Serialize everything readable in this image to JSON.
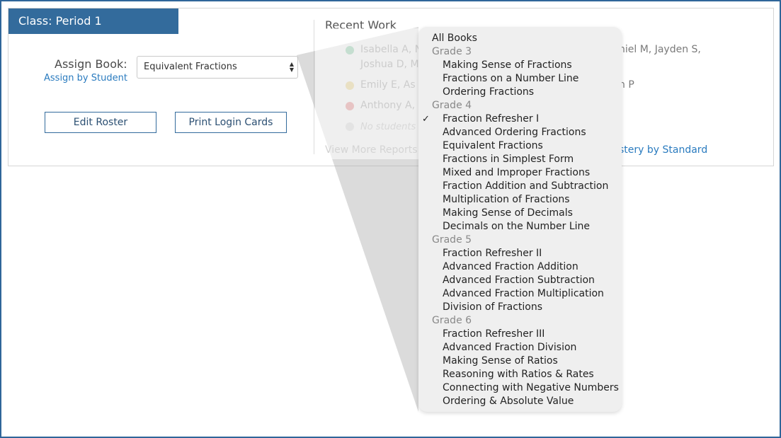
{
  "class_header": "Class: Period 1",
  "assign": {
    "label": "Assign Book:",
    "by_student_link": "Assign by Student",
    "selected_book": "Equivalent Fractions"
  },
  "buttons": {
    "edit_roster": "Edit Roster",
    "print_login_cards": "Print Login Cards"
  },
  "recent_work": {
    "title": "Recent Work",
    "rows": [
      {
        "color": "#5fbf8a",
        "text": "Isabella A, N",
        "right": "niel M, Jayden S,"
      },
      {
        "text": "Joshua D, M"
      },
      {
        "color": "#e9c85a",
        "text": "Emily E, As",
        "right": "h P"
      },
      {
        "color": "#e45c5c",
        "text": "Anthony A,"
      },
      {
        "color": "#d0d0d0",
        "text": "No students"
      }
    ],
    "view_more": "View More Reports",
    "mastery_link": "stery by Standard"
  },
  "dropdown": {
    "items": [
      {
        "label": "All Books",
        "type": "option",
        "indent": 0
      },
      {
        "label": "Grade 3",
        "type": "group"
      },
      {
        "label": "Making Sense of Fractions",
        "type": "option"
      },
      {
        "label": "Fractions on a Number Line",
        "type": "option"
      },
      {
        "label": "Ordering Fractions",
        "type": "option"
      },
      {
        "label": "Grade 4",
        "type": "group"
      },
      {
        "label": "Fraction Refresher I",
        "type": "option",
        "checked": true
      },
      {
        "label": "Advanced Ordering Fractions",
        "type": "option"
      },
      {
        "label": "Equivalent Fractions",
        "type": "option"
      },
      {
        "label": "Fractions in Simplest Form",
        "type": "option"
      },
      {
        "label": "Mixed and Improper Fractions",
        "type": "option"
      },
      {
        "label": "Fraction Addition and Subtraction",
        "type": "option"
      },
      {
        "label": "Multiplication of Fractions",
        "type": "option"
      },
      {
        "label": "Making Sense of Decimals",
        "type": "option"
      },
      {
        "label": "Decimals on the Number Line",
        "type": "option"
      },
      {
        "label": "Grade 5",
        "type": "group"
      },
      {
        "label": "Fraction Refresher II",
        "type": "option"
      },
      {
        "label": "Advanced Fraction Addition",
        "type": "option"
      },
      {
        "label": "Advanced Fraction Subtraction",
        "type": "option"
      },
      {
        "label": "Advanced Fraction Multiplication",
        "type": "option"
      },
      {
        "label": "Division of Fractions",
        "type": "option"
      },
      {
        "label": "Grade 6",
        "type": "group"
      },
      {
        "label": "Fraction Refresher III",
        "type": "option"
      },
      {
        "label": "Advanced Fraction Division",
        "type": "option"
      },
      {
        "label": "Making Sense of Ratios",
        "type": "option"
      },
      {
        "label": "Reasoning with Ratios & Rates",
        "type": "option"
      },
      {
        "label": "Connecting with Negative Numbers",
        "type": "option"
      },
      {
        "label": "Ordering & Absolute Value",
        "type": "option"
      }
    ],
    "check_glyph": "✓"
  }
}
